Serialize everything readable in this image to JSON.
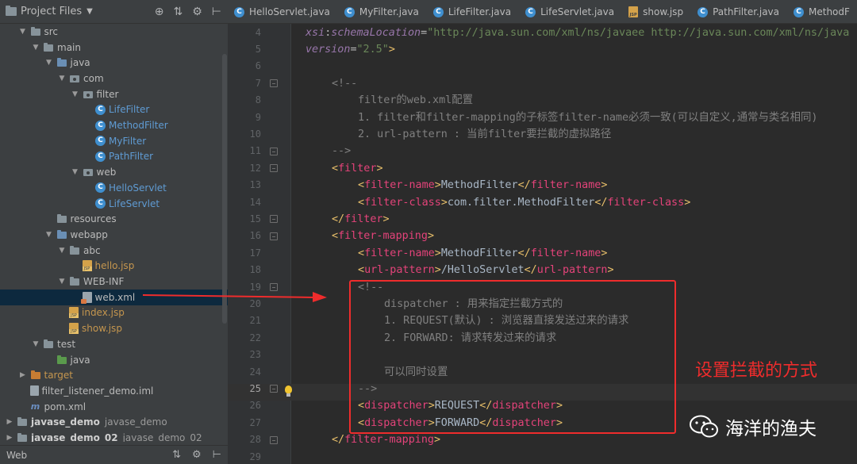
{
  "project_panel": {
    "title": "Project Files",
    "tree": [
      {
        "label": "src",
        "depth": 1,
        "icon": "folder",
        "expanded": true
      },
      {
        "label": "main",
        "depth": 2,
        "icon": "folder",
        "expanded": true
      },
      {
        "label": "java",
        "depth": 3,
        "icon": "folder-blue",
        "expanded": true
      },
      {
        "label": "com",
        "depth": 4,
        "icon": "package",
        "expanded": true
      },
      {
        "label": "filter",
        "depth": 5,
        "icon": "package",
        "expanded": true
      },
      {
        "label": "LifeFilter",
        "depth": 6,
        "icon": "class"
      },
      {
        "label": "MethodFilter",
        "depth": 6,
        "icon": "class"
      },
      {
        "label": "MyFilter",
        "depth": 6,
        "icon": "class"
      },
      {
        "label": "PathFilter",
        "depth": 6,
        "icon": "class"
      },
      {
        "label": "web",
        "depth": 5,
        "icon": "package",
        "expanded": true
      },
      {
        "label": "HelloServlet",
        "depth": 6,
        "icon": "class"
      },
      {
        "label": "LifeServlet",
        "depth": 6,
        "icon": "class"
      },
      {
        "label": "resources",
        "depth": 3,
        "icon": "folder-res"
      },
      {
        "label": "webapp",
        "depth": 3,
        "icon": "folder-web",
        "expanded": true
      },
      {
        "label": "abc",
        "depth": 4,
        "icon": "folder",
        "expanded": true
      },
      {
        "label": "hello.jsp",
        "depth": 5,
        "icon": "jsp"
      },
      {
        "label": "WEB-INF",
        "depth": 4,
        "icon": "folder",
        "expanded": true
      },
      {
        "label": "web.xml",
        "depth": 5,
        "icon": "xml",
        "selected": true
      },
      {
        "label": "index.jsp",
        "depth": 4,
        "icon": "jsp"
      },
      {
        "label": "show.jsp",
        "depth": 4,
        "icon": "jsp"
      },
      {
        "label": "test",
        "depth": 2,
        "icon": "folder",
        "expanded": true
      },
      {
        "label": "java",
        "depth": 3,
        "icon": "folder-green"
      },
      {
        "label": "target",
        "depth": 1,
        "icon": "folder-orange",
        "collapsed": true
      },
      {
        "label": "filter_listener_demo.iml",
        "depth": 1,
        "icon": "iml"
      },
      {
        "label": "pom.xml",
        "depth": 1,
        "icon": "maven"
      },
      {
        "label": "javase_demo",
        "depth": 0,
        "icon": "folder",
        "collapsed": true,
        "module": "javase_demo"
      },
      {
        "label": "javase_demo_02",
        "depth": 0,
        "icon": "folder",
        "collapsed": true,
        "module": "javase_demo_02"
      }
    ],
    "footer_title": "Web"
  },
  "tabs": [
    {
      "label": "HelloServlet.java",
      "icon": "class"
    },
    {
      "label": "MyFilter.java",
      "icon": "class"
    },
    {
      "label": "LifeFilter.java",
      "icon": "class"
    },
    {
      "label": "LifeServlet.java",
      "icon": "class"
    },
    {
      "label": "show.jsp",
      "icon": "jsp"
    },
    {
      "label": "PathFilter.java",
      "icon": "class"
    },
    {
      "label": "MethodF",
      "icon": "class"
    }
  ],
  "editor": {
    "current_line": 25,
    "lines": [
      {
        "n": 4,
        "indent": 0,
        "tokens": [
          [
            "k-ns",
            "xsi"
          ],
          [
            "k-attr",
            ":"
          ],
          [
            "k-ns",
            "schemaLocation"
          ],
          [
            "k-attr",
            "="
          ],
          [
            "k-str",
            "\"http://java.sun.com/xml/ns/javaee http://java.sun.com/xml/ns/java"
          ]
        ]
      },
      {
        "n": 5,
        "indent": 0,
        "tokens": [
          [
            "k-ns",
            "version"
          ],
          [
            "k-attr",
            "="
          ],
          [
            "k-str",
            "\"2.5\""
          ],
          [
            "k-bracket",
            ">"
          ]
        ]
      },
      {
        "n": 6,
        "indent": 0,
        "tokens": []
      },
      {
        "n": 7,
        "indent": 1,
        "tokens": [
          [
            "k-cmt",
            "<!--"
          ]
        ],
        "fold": true
      },
      {
        "n": 8,
        "indent": 2,
        "tokens": [
          [
            "k-cmt",
            "filter的web.xml配置"
          ]
        ]
      },
      {
        "n": 9,
        "indent": 2,
        "tokens": [
          [
            "k-cmt",
            "1. filter和filter-mapping的子标签filter-name必须一致(可以自定义,通常与类名相同)"
          ]
        ]
      },
      {
        "n": 10,
        "indent": 2,
        "tokens": [
          [
            "k-cmt",
            "2. url-pattern : 当前filter要拦截的虚拟路径"
          ]
        ]
      },
      {
        "n": 11,
        "indent": 1,
        "tokens": [
          [
            "k-cmt",
            "-->"
          ]
        ],
        "fold": true
      },
      {
        "n": 12,
        "indent": 1,
        "tokens": [
          [
            "k-bracket",
            "<"
          ],
          [
            "k-tag-pink",
            "filter"
          ],
          [
            "k-bracket",
            ">"
          ]
        ],
        "fold": true
      },
      {
        "n": 13,
        "indent": 2,
        "tokens": [
          [
            "k-bracket",
            "<"
          ],
          [
            "k-tag-pink",
            "filter-name"
          ],
          [
            "k-bracket",
            ">"
          ],
          [
            "k-text",
            "MethodFilter"
          ],
          [
            "k-bracket",
            "</"
          ],
          [
            "k-tag-pink",
            "filter-name"
          ],
          [
            "k-bracket",
            ">"
          ]
        ]
      },
      {
        "n": 14,
        "indent": 2,
        "tokens": [
          [
            "k-bracket",
            "<"
          ],
          [
            "k-tag-pink",
            "filter-class"
          ],
          [
            "k-bracket",
            ">"
          ],
          [
            "k-text",
            "com.filter.MethodFilter"
          ],
          [
            "k-bracket",
            "</"
          ],
          [
            "k-tag-pink",
            "filter-class"
          ],
          [
            "k-bracket",
            ">"
          ]
        ]
      },
      {
        "n": 15,
        "indent": 1,
        "tokens": [
          [
            "k-bracket",
            "</"
          ],
          [
            "k-tag-pink",
            "filter"
          ],
          [
            "k-bracket",
            ">"
          ]
        ],
        "fold": true
      },
      {
        "n": 16,
        "indent": 1,
        "tokens": [
          [
            "k-bracket",
            "<"
          ],
          [
            "k-tag-pink",
            "filter-mapping"
          ],
          [
            "k-bracket",
            ">"
          ]
        ],
        "fold": true
      },
      {
        "n": 17,
        "indent": 2,
        "tokens": [
          [
            "k-bracket",
            "<"
          ],
          [
            "k-tag-pink",
            "filter-name"
          ],
          [
            "k-bracket",
            ">"
          ],
          [
            "k-text",
            "MethodFilter"
          ],
          [
            "k-bracket",
            "</"
          ],
          [
            "k-tag-pink",
            "filter-name"
          ],
          [
            "k-bracket",
            ">"
          ]
        ]
      },
      {
        "n": 18,
        "indent": 2,
        "tokens": [
          [
            "k-bracket",
            "<"
          ],
          [
            "k-tag-pink",
            "url-pattern"
          ],
          [
            "k-bracket",
            ">"
          ],
          [
            "k-text",
            "/HelloServlet"
          ],
          [
            "k-bracket",
            "</"
          ],
          [
            "k-tag-pink",
            "url-pattern"
          ],
          [
            "k-bracket",
            ">"
          ]
        ]
      },
      {
        "n": 19,
        "indent": 2,
        "tokens": [
          [
            "k-cmt",
            "<!--"
          ]
        ],
        "fold": true
      },
      {
        "n": 20,
        "indent": 3,
        "tokens": [
          [
            "k-cmt",
            "dispatcher : 用来指定拦截方式的"
          ]
        ]
      },
      {
        "n": 21,
        "indent": 3,
        "tokens": [
          [
            "k-cmt",
            "1. REQUEST(默认) : 浏览器直接发送过来的请求"
          ]
        ]
      },
      {
        "n": 22,
        "indent": 3,
        "tokens": [
          [
            "k-cmt",
            "2. FORWARD: 请求转发过来的请求"
          ]
        ]
      },
      {
        "n": 23,
        "indent": 0,
        "tokens": []
      },
      {
        "n": 24,
        "indent": 3,
        "tokens": [
          [
            "k-cmt",
            "可以同时设置"
          ]
        ]
      },
      {
        "n": 25,
        "indent": 2,
        "tokens": [
          [
            "k-cmt",
            "-->"
          ]
        ],
        "fold": true
      },
      {
        "n": 26,
        "indent": 2,
        "tokens": [
          [
            "k-bracket",
            "<"
          ],
          [
            "k-tag-pink",
            "dispatcher"
          ],
          [
            "k-bracket",
            ">"
          ],
          [
            "k-text",
            "REQUEST"
          ],
          [
            "k-bracket",
            "</"
          ],
          [
            "k-tag-pink",
            "dispatcher"
          ],
          [
            "k-bracket",
            ">"
          ]
        ]
      },
      {
        "n": 27,
        "indent": 2,
        "tokens": [
          [
            "k-bracket",
            "<"
          ],
          [
            "k-tag-pink",
            "dispatcher"
          ],
          [
            "k-bracket",
            ">"
          ],
          [
            "k-text",
            "FORWARD"
          ],
          [
            "k-bracket",
            "</"
          ],
          [
            "k-tag-pink",
            "dispatcher"
          ],
          [
            "k-bracket",
            ">"
          ]
        ]
      },
      {
        "n": 28,
        "indent": 1,
        "tokens": [
          [
            "k-bracket",
            "</"
          ],
          [
            "k-tag-pink",
            "filter-mapping"
          ],
          [
            "k-bracket",
            ">"
          ]
        ],
        "fold": true
      },
      {
        "n": 29,
        "indent": 0,
        "tokens": []
      }
    ]
  },
  "annotation": {
    "label": "设置拦截的方式",
    "color": "#ef2c2c"
  },
  "watermark": {
    "text": "海洋的渔夫"
  }
}
